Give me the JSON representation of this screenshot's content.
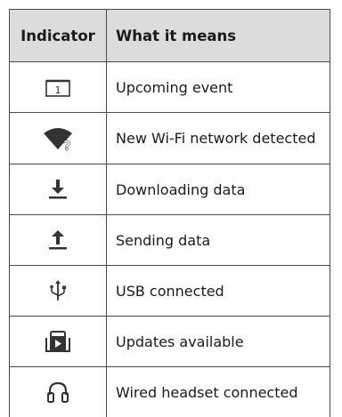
{
  "table": {
    "header": {
      "indicator": "Indicator",
      "meaning": "What it means"
    },
    "rows": [
      {
        "icon": "calendar-icon",
        "icon_text": "1",
        "label": "Upcoming event"
      },
      {
        "icon": "wifi-unknown-icon",
        "label": "New Wi-Fi network detected"
      },
      {
        "icon": "download-icon",
        "label": "Downloading data"
      },
      {
        "icon": "upload-icon",
        "label": "Sending data"
      },
      {
        "icon": "usb-icon",
        "label": "USB connected"
      },
      {
        "icon": "play-store-icon",
        "label": "Updates available"
      },
      {
        "icon": "headset-icon",
        "label": "Wired headset connected"
      }
    ]
  },
  "colors": {
    "header_bg": "#dcdcdc",
    "border": "#4a4a4a",
    "icon": "#333333"
  }
}
